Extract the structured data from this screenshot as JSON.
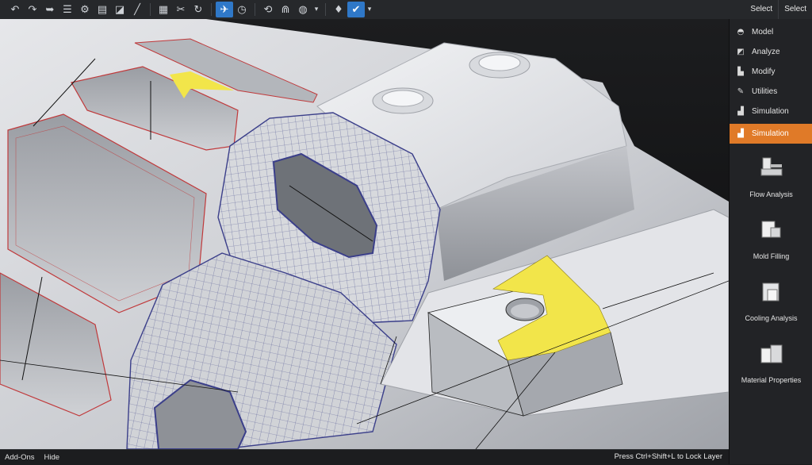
{
  "toolbar": {
    "tools": [
      {
        "name": "undo-icon",
        "glyph": "↶"
      },
      {
        "name": "redo-icon",
        "glyph": "↷"
      },
      {
        "name": "repeat-icon",
        "glyph": "➥"
      },
      {
        "name": "list-edit-icon",
        "glyph": "☰"
      },
      {
        "name": "assembly-icon",
        "glyph": "⚙"
      },
      {
        "name": "window-icon",
        "glyph": "▤"
      },
      {
        "name": "bookmark-icon",
        "glyph": "◪"
      },
      {
        "name": "pen-icon",
        "glyph": "╱"
      },
      {
        "name": "panel-icon",
        "glyph": "▦"
      },
      {
        "name": "cut-icon",
        "glyph": "✂"
      },
      {
        "name": "rotate-icon",
        "glyph": "↻"
      },
      {
        "name": "plane-icon",
        "glyph": "✈"
      },
      {
        "name": "clock-icon",
        "glyph": "◷"
      },
      {
        "name": "loop-icon",
        "glyph": "⟲"
      },
      {
        "name": "section-icon",
        "glyph": "⋒"
      },
      {
        "name": "globe-icon",
        "glyph": "◍"
      },
      {
        "name": "pin-icon",
        "glyph": "♦"
      },
      {
        "name": "check-icon",
        "glyph": "✔"
      }
    ],
    "right_select_1": "Select",
    "right_select_2": "Select",
    "accent_color": "#2f78c8"
  },
  "panel": {
    "nav": [
      {
        "label": "Model",
        "icon": "model-icon"
      },
      {
        "label": "Analyze",
        "icon": "analyze-icon"
      },
      {
        "label": "Modify",
        "icon": "modify-icon"
      },
      {
        "label": "Utilities",
        "icon": "utilities-icon"
      },
      {
        "label": "Simulation",
        "icon": "simulation-icon"
      }
    ],
    "active": {
      "label": "Simulation",
      "icon": "simulation-icon"
    },
    "active_color": "#e07a28",
    "tools": [
      {
        "label": "Flow Analysis",
        "icon": "flow-analysis-icon"
      },
      {
        "label": "Mold Filling",
        "icon": "mold-filling-icon"
      },
      {
        "label": "Cooling Analysis",
        "icon": "cooling-analysis-icon"
      },
      {
        "label": "Material Properties",
        "icon": "material-properties-icon"
      }
    ]
  },
  "statusbar": {
    "addons": "Add-Ons",
    "hide": "Hide",
    "hint": "Press Ctrl+Shift+L to Lock Layer"
  },
  "viewport": {
    "highlight_color": "#f2e54a",
    "mesh_color": "#3b3f8a",
    "edge_color": "#c0393b"
  }
}
